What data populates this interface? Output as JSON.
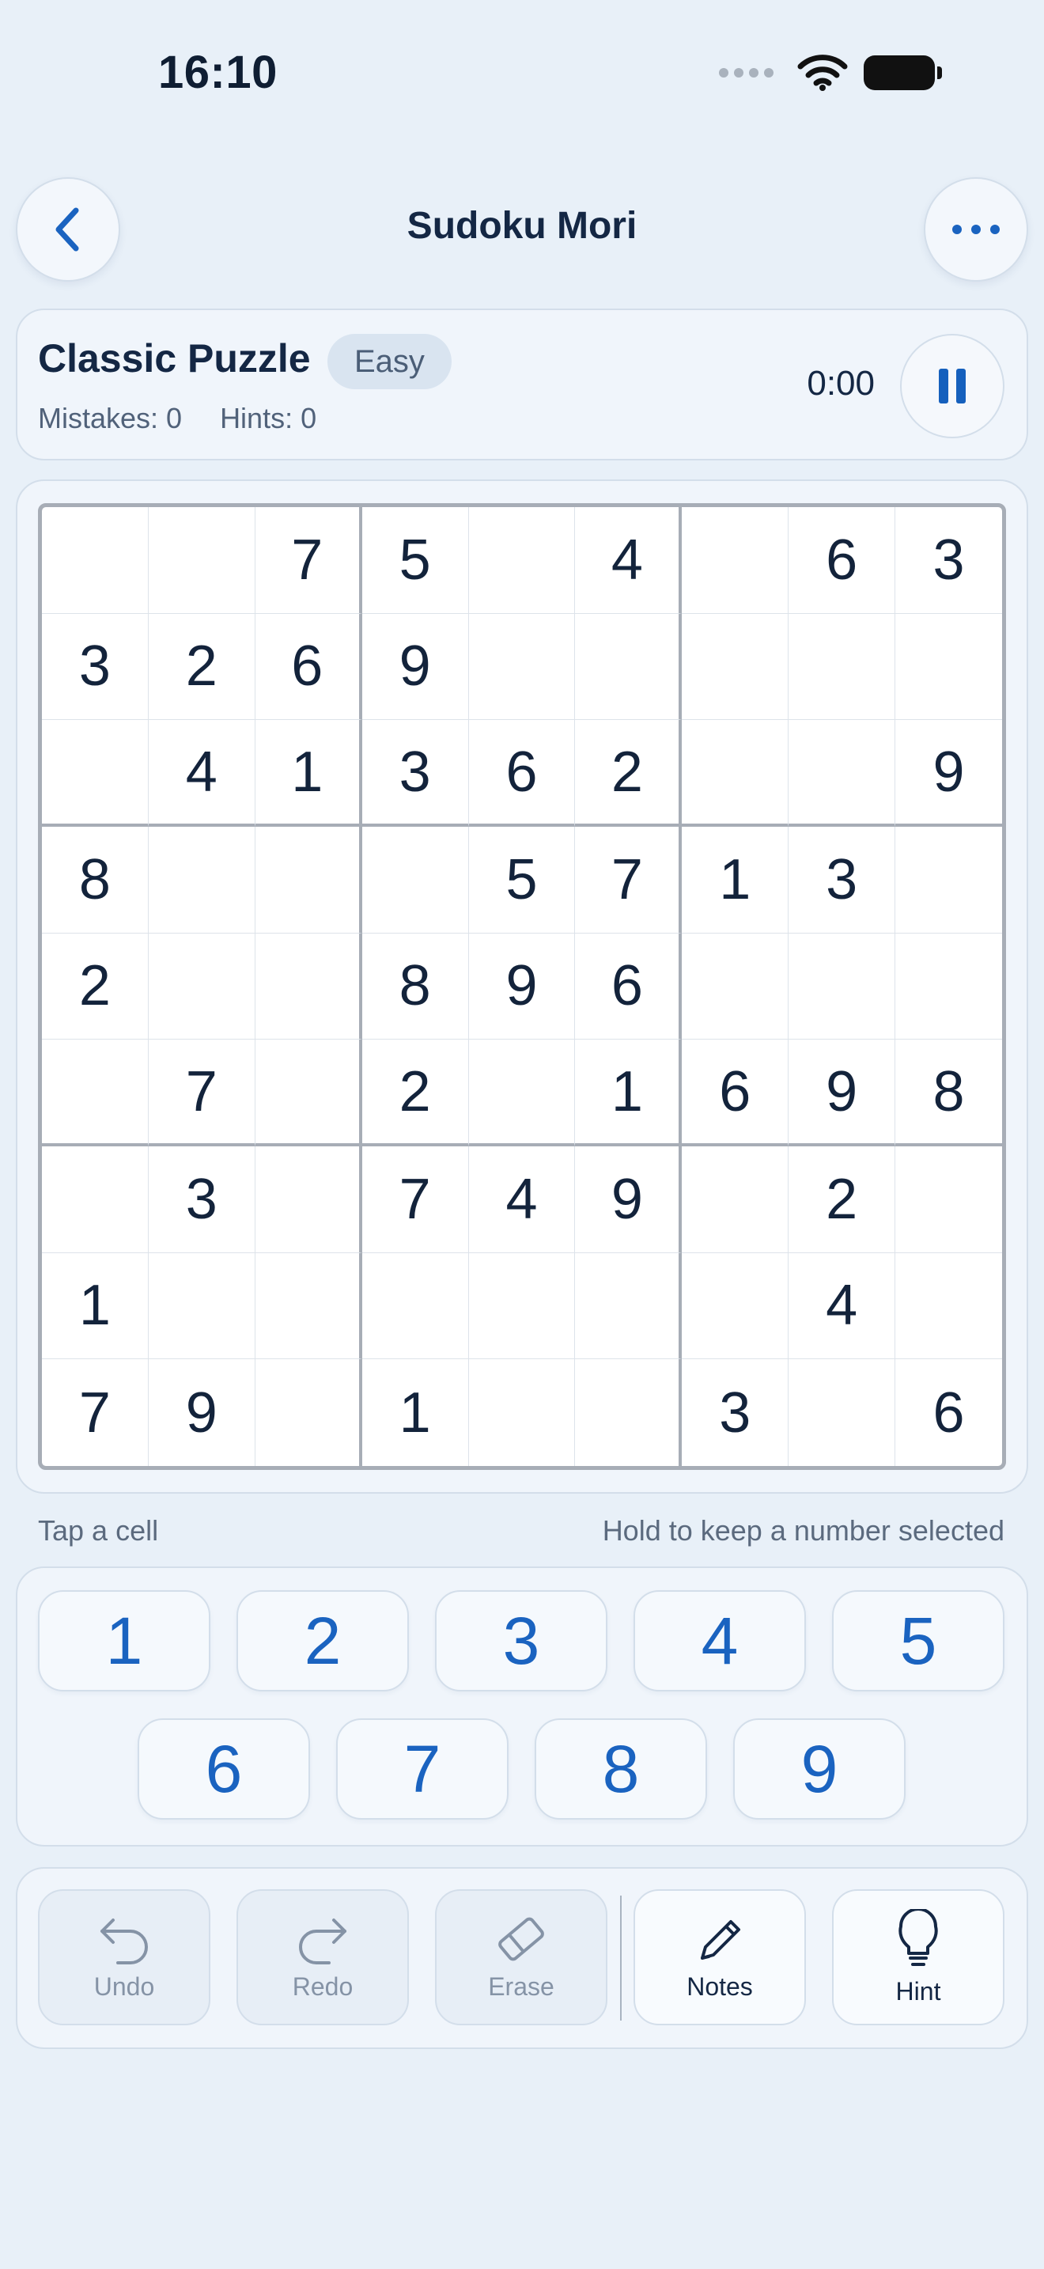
{
  "status_bar": {
    "time": "16:10"
  },
  "header": {
    "title": "Sudoku Mori"
  },
  "puzzle": {
    "title": "Classic Puzzle",
    "difficulty": "Easy",
    "mistakes_label": "Mistakes: 0",
    "hints_label": "Hints: 0",
    "timer": "0:00"
  },
  "board": {
    "cells": [
      [
        "",
        "",
        "7",
        "5",
        "",
        "4",
        "",
        "6",
        "3"
      ],
      [
        "3",
        "2",
        "6",
        "9",
        "",
        "",
        "",
        "",
        ""
      ],
      [
        "",
        "4",
        "1",
        "3",
        "6",
        "2",
        "",
        "",
        "9"
      ],
      [
        "8",
        "",
        "",
        "",
        "5",
        "7",
        "1",
        "3",
        ""
      ],
      [
        "2",
        "",
        "",
        "8",
        "9",
        "6",
        "",
        "",
        ""
      ],
      [
        "",
        "7",
        "",
        "2",
        "",
        "1",
        "6",
        "9",
        "8"
      ],
      [
        "",
        "3",
        "",
        "7",
        "4",
        "9",
        "",
        "2",
        ""
      ],
      [
        "1",
        "",
        "",
        "",
        "",
        "",
        "",
        "4",
        ""
      ],
      [
        "7",
        "9",
        "",
        "1",
        "",
        "",
        "3",
        "",
        "6"
      ]
    ]
  },
  "helper": {
    "left": "Tap a cell",
    "right": "Hold to keep a number selected"
  },
  "numpad": [
    "1",
    "2",
    "3",
    "4",
    "5",
    "6",
    "7",
    "8",
    "9"
  ],
  "tools": {
    "undo": "Undo",
    "redo": "Redo",
    "erase": "Erase",
    "notes": "Notes",
    "hint": "Hint"
  },
  "colors": {
    "accent": "#1a63c0",
    "background": "#e8f0f8",
    "given_digit": "#13233b"
  }
}
